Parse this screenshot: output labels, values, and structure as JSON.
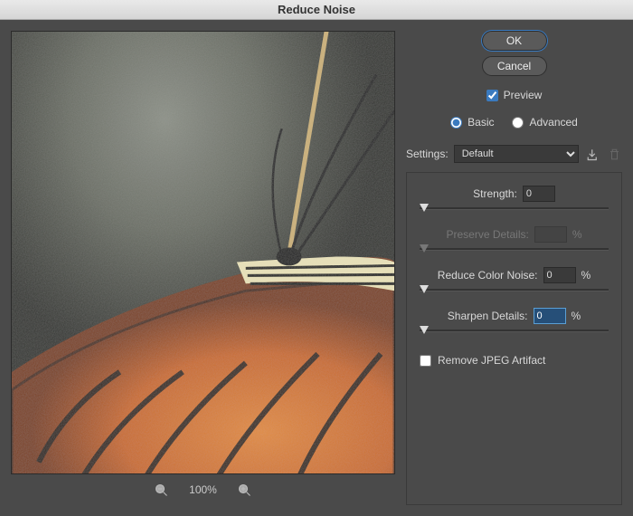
{
  "title": "Reduce Noise",
  "buttons": {
    "ok": "OK",
    "cancel": "Cancel"
  },
  "preview_label": "Preview",
  "preview_checked": true,
  "mode": {
    "basic": "Basic",
    "advanced": "Advanced",
    "selected": "basic"
  },
  "settings": {
    "label": "Settings:",
    "value": "Default"
  },
  "params": {
    "strength": {
      "label": "Strength:",
      "value": "0"
    },
    "preserve": {
      "label": "Preserve Details:",
      "value": "",
      "unit": "%"
    },
    "color": {
      "label": "Reduce Color Noise:",
      "value": "0",
      "unit": "%"
    },
    "sharpen": {
      "label": "Sharpen Details:",
      "value": "0",
      "unit": "%"
    }
  },
  "jpeg_label": "Remove JPEG Artifact",
  "zoom": "100%"
}
